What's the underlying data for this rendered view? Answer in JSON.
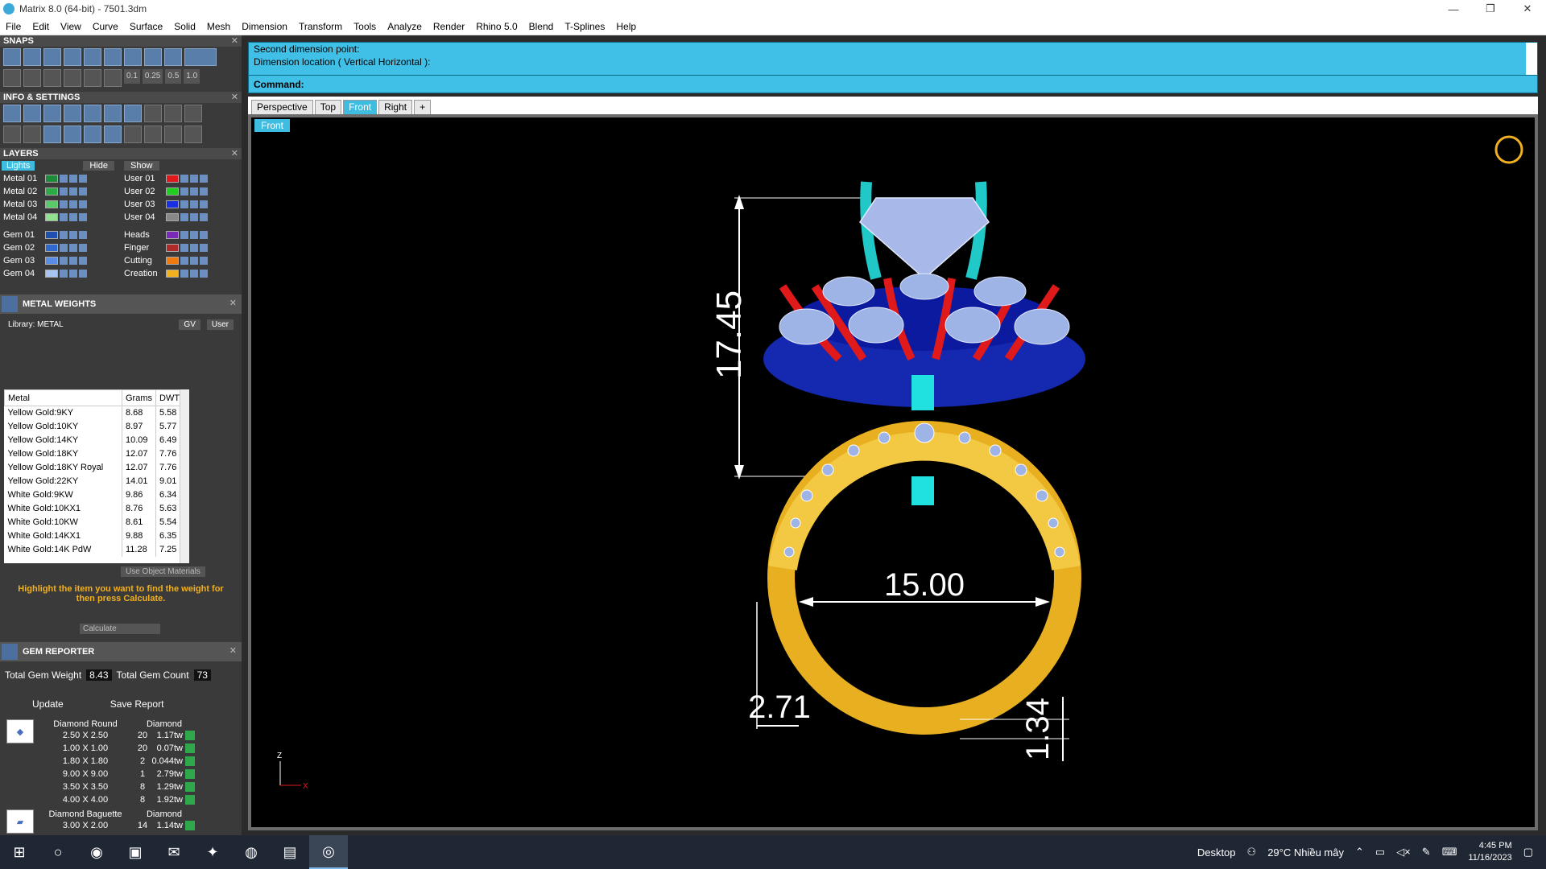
{
  "window": {
    "title": "Matrix 8.0 (64-bit) - 7501.3dm",
    "min": "—",
    "max": "❐",
    "close": "✕"
  },
  "menu": [
    "File",
    "Edit",
    "View",
    "Curve",
    "Surface",
    "Solid",
    "Mesh",
    "Dimension",
    "Transform",
    "Tools",
    "Analyze",
    "Render",
    "Rhino 5.0",
    "Blend",
    "T-Splines",
    "Help"
  ],
  "panels": {
    "snaps": "SNAPS",
    "info": "INFO & SETTINGS",
    "layers": "LAYERS",
    "snap_values": [
      "0.1",
      "0.25",
      "0.5",
      "1.0"
    ]
  },
  "layers": {
    "lights": "Lights",
    "hide": "Hide",
    "show": "Show",
    "left": [
      {
        "name": "Metal 01",
        "color": "#1f8a3a"
      },
      {
        "name": "Metal 02",
        "color": "#2eab49"
      },
      {
        "name": "Metal 03",
        "color": "#59c868"
      },
      {
        "name": "Metal 04",
        "color": "#8fe08f"
      },
      {
        "name": "Gem 01",
        "color": "#1f4fb0"
      },
      {
        "name": "Gem 02",
        "color": "#2f68cf"
      },
      {
        "name": "Gem 03",
        "color": "#5a8ee6"
      },
      {
        "name": "Gem 04",
        "color": "#a7c4f2"
      }
    ],
    "right": [
      {
        "name": "User 01",
        "color": "#e01a1a"
      },
      {
        "name": "User 02",
        "color": "#1fcf1f"
      },
      {
        "name": "User 03",
        "color": "#1a2fe0"
      },
      {
        "name": "User 04",
        "color": "#888888"
      },
      {
        "name": "Heads",
        "color": "#7a2ab8"
      },
      {
        "name": "Finger",
        "color": "#b02a2a"
      },
      {
        "name": "Cutting",
        "color": "#f07a10"
      },
      {
        "name": "Creation",
        "color": "#f0b020"
      }
    ]
  },
  "metal_weights": {
    "title": "METAL WEIGHTS",
    "library": "Library: METAL",
    "gv": "GV",
    "user": "User",
    "columns": [
      "Metal",
      "Grams",
      "DWT"
    ],
    "rows": [
      [
        "Yellow Gold:9KY",
        "8.68",
        "5.58"
      ],
      [
        "Yellow Gold:10KY",
        "8.97",
        "5.77"
      ],
      [
        "Yellow Gold:14KY",
        "10.09",
        "6.49"
      ],
      [
        "Yellow Gold:18KY",
        "12.07",
        "7.76"
      ],
      [
        "Yellow Gold:18KY Royal",
        "12.07",
        "7.76"
      ],
      [
        "Yellow Gold:22KY",
        "14.01",
        "9.01"
      ],
      [
        "White Gold:9KW",
        "9.86",
        "6.34"
      ],
      [
        "White Gold:10KX1",
        "8.76",
        "5.63"
      ],
      [
        "White Gold:10KW",
        "8.61",
        "5.54"
      ],
      [
        "White Gold:14KX1",
        "9.88",
        "6.35"
      ],
      [
        "White Gold:14K PdW",
        "11.28",
        "7.25"
      ]
    ],
    "use_object_materials": "Use Object Materials",
    "hint": "Highlight the item you want to find the weight for then press Calculate.",
    "calculate": "Calculate"
  },
  "gem_reporter": {
    "title": "GEM REPORTER",
    "total_weight_label": "Total Gem Weight",
    "total_weight": "8.43",
    "total_count_label": "Total Gem Count",
    "total_count": "73",
    "update": "Update",
    "save_report": "Save Report",
    "groups": [
      {
        "shape": "Diamond Round",
        "material": "Diamond",
        "rows": [
          [
            "2.50 X 2.50",
            "20",
            "1.17tw"
          ],
          [
            "1.00 X 1.00",
            "20",
            "0.07tw"
          ],
          [
            "1.80 X 1.80",
            "2",
            "0.044tw"
          ],
          [
            "9.00 X 9.00",
            "1",
            "2.79tw"
          ],
          [
            "3.50 X 3.50",
            "8",
            "1.29tw"
          ],
          [
            "4.00 X 4.00",
            "8",
            "1.92tw"
          ]
        ]
      },
      {
        "shape": "Diamond Baguette",
        "material": "Diamond",
        "rows": [
          [
            "3.00 X 2.00",
            "14",
            "1.14tw"
          ]
        ]
      }
    ]
  },
  "command": {
    "line1": "Second dimension point:",
    "line2": "Dimension location ( Vertical  Horizontal ):",
    "prompt": "Command:"
  },
  "viewport_tabs": [
    "Perspective",
    "Top",
    "Front",
    "Right",
    "+"
  ],
  "active_tab": "Front",
  "viewport_label": "Front",
  "dimensions": {
    "height": "17.45",
    "inner": "15.00",
    "shank_width": "2.71",
    "shank_thickness": "1.34"
  },
  "axis": {
    "z": "Z",
    "x": "X"
  },
  "taskbar": {
    "desktop": "Desktop",
    "weather": "29°C  Nhiều mây",
    "time": "4:45 PM",
    "date": "11/16/2023"
  },
  "colors": {
    "command_bg": "#40c0e6",
    "viewport_bg": "#000000",
    "gold": "#e8b020"
  }
}
